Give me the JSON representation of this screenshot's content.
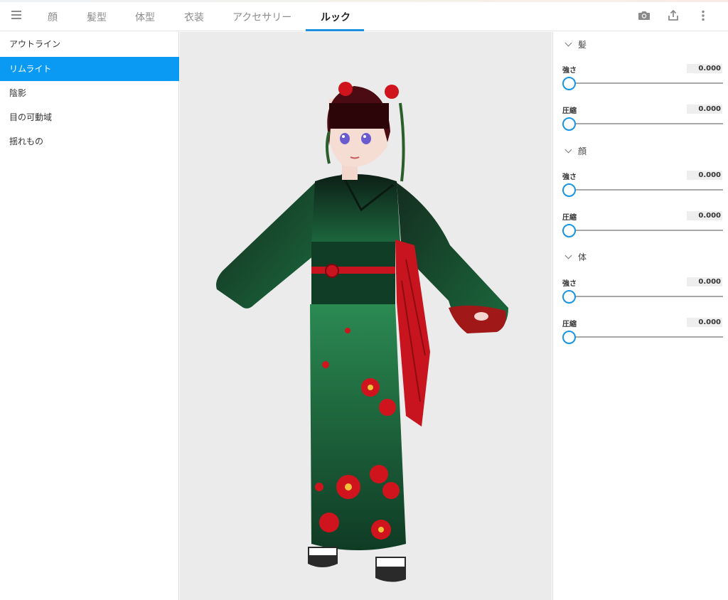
{
  "toolbar": {
    "tabs": [
      "顔",
      "髪型",
      "体型",
      "衣装",
      "アクセサリー",
      "ルック"
    ],
    "active_tab": "ルック",
    "icons": [
      "menu-icon",
      "camera-icon",
      "share-icon",
      "more-vert-icon"
    ]
  },
  "sidebar": {
    "items": [
      "アウトライン",
      "リムライト",
      "陰影",
      "目の可動域",
      "揺れもの"
    ],
    "active_item": "リムライト"
  },
  "panel": {
    "sections": [
      {
        "title": "髪",
        "sliders": [
          {
            "label": "強さ",
            "value": "0.000"
          },
          {
            "label": "圧縮",
            "value": "0.000"
          }
        ]
      },
      {
        "title": "顔",
        "sliders": [
          {
            "label": "強さ",
            "value": "0.000"
          },
          {
            "label": "圧縮",
            "value": "0.000"
          }
        ]
      },
      {
        "title": "体",
        "sliders": [
          {
            "label": "強さ",
            "value": "0.000"
          },
          {
            "label": "圧縮",
            "value": "0.000"
          }
        ]
      }
    ]
  },
  "colors": {
    "accent": "#0b9af3",
    "slider_thumb": "#1894e6",
    "viewport_bg": "#ebebeb",
    "kimono_green": "#1f6b3f",
    "obi_red": "#c8141e"
  }
}
